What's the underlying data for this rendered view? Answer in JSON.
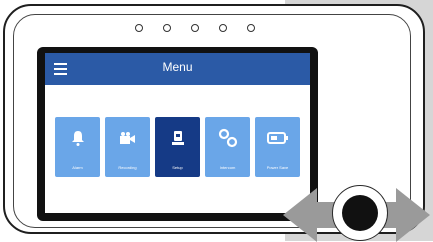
{
  "screen": {
    "title": "Menu"
  },
  "tiles": [
    {
      "id": "alarm",
      "label": "Alarm",
      "icon": "bell-icon",
      "active": false
    },
    {
      "id": "recording",
      "label": "Recording",
      "icon": "camera-icon",
      "active": false
    },
    {
      "id": "setup",
      "label": "Setup",
      "icon": "wrench-icon",
      "active": true
    },
    {
      "id": "intercom",
      "label": "Intercom",
      "icon": "link-icon",
      "active": false
    },
    {
      "id": "power",
      "label": "Power Save",
      "icon": "battery-icon",
      "active": false
    }
  ],
  "colors": {
    "topbar": "#2b5aa6",
    "tile": "#6aa6e8",
    "tile_active": "#153a86",
    "arrows": "#9a9a9a"
  }
}
